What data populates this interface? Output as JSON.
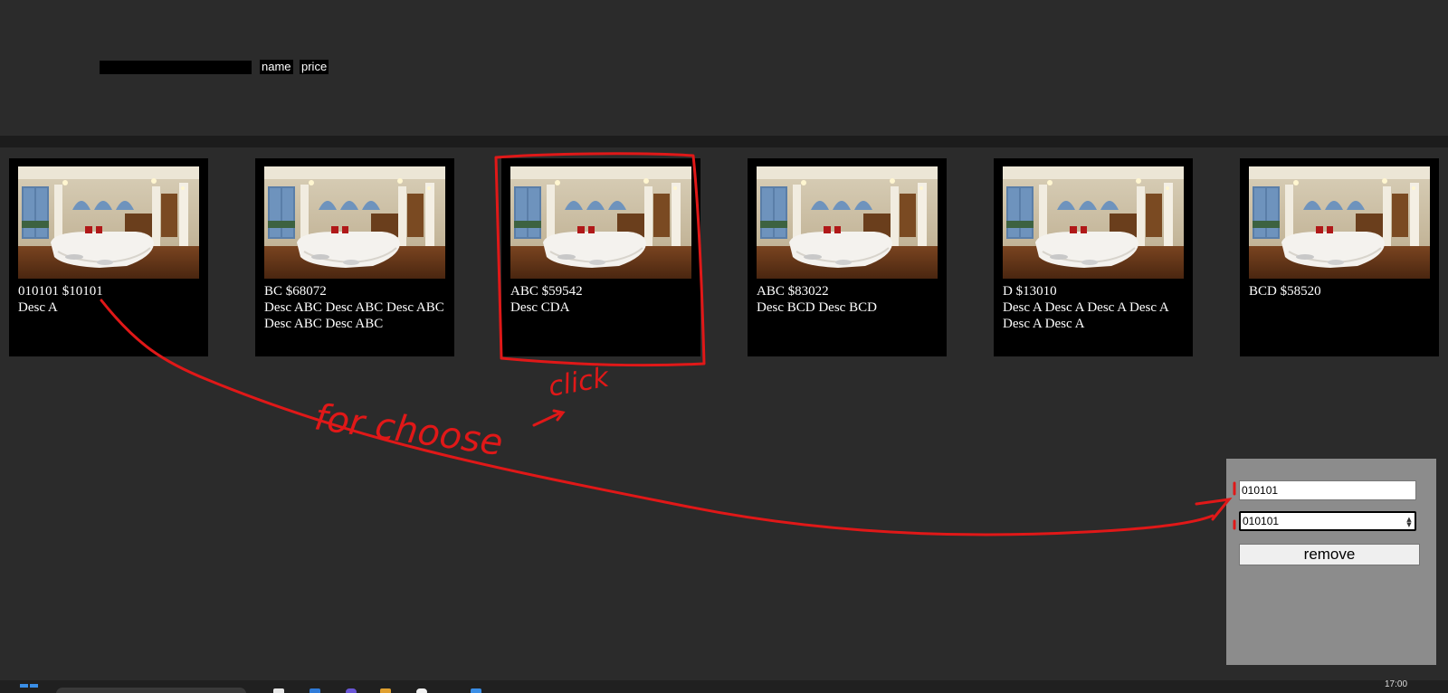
{
  "search": {
    "value": "",
    "placeholder": ""
  },
  "sort_buttons": {
    "name": "name",
    "price": "price"
  },
  "products": [
    {
      "title": "010101 $10101",
      "desc": "Desc A"
    },
    {
      "title": "BC $68072",
      "desc": "Desc ABC Desc ABC Desc ABC Desc ABC Desc ABC"
    },
    {
      "title": "ABC $59542",
      "desc": "Desc CDA"
    },
    {
      "title": "ABC $83022",
      "desc": "Desc BCD Desc BCD"
    },
    {
      "title": "D $13010",
      "desc": "Desc A Desc A Desc A Desc A Desc A Desc A"
    },
    {
      "title": "BCD $58520",
      "desc": ""
    }
  ],
  "edit_panel": {
    "name_value": "010101",
    "price_value": "010101",
    "remove_label": "remove"
  },
  "annotations": {
    "for_choose": "for choose",
    "click": "click"
  },
  "taskbar": {
    "clock": "17:00"
  },
  "colors": {
    "page_bg": "#2b2b2b",
    "card_bg": "#000000",
    "panel_bg": "#8c8c8c",
    "annotation": "#e01818"
  },
  "icons": [
    "windows-start-icon",
    "taskbar-app-icon"
  ]
}
